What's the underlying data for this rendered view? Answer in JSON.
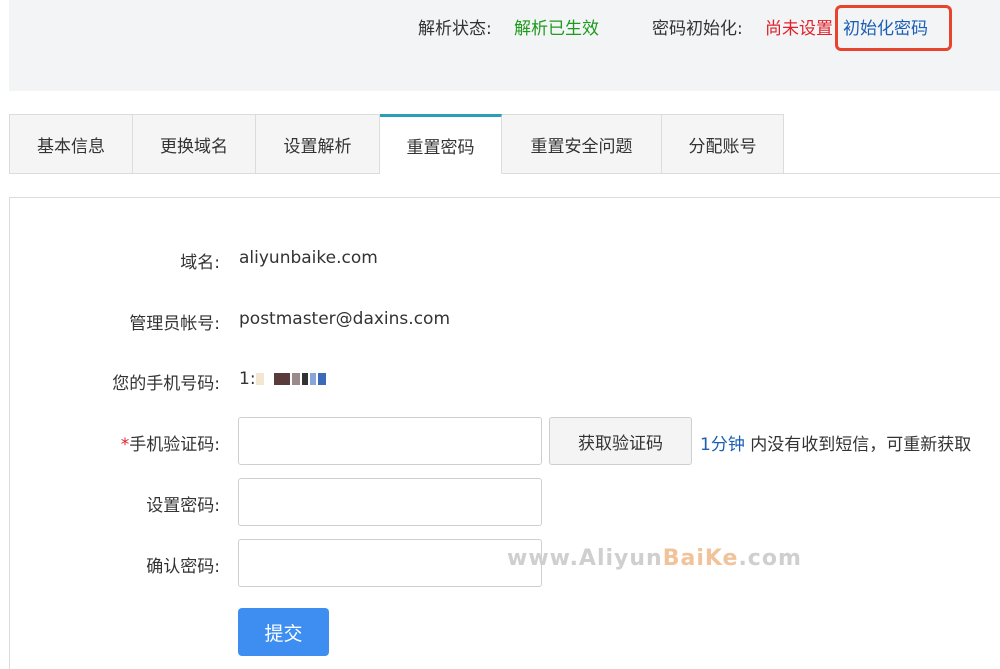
{
  "status": {
    "resolve_label": "解析状态:",
    "resolve_value": "解析已生效",
    "pwd_init_label": "密码初始化:",
    "pwd_init_value": "尚未设置",
    "init_button": "初始化密码"
  },
  "tabs": [
    {
      "label": "基本信息",
      "active": false
    },
    {
      "label": "更换域名",
      "active": false
    },
    {
      "label": "设置解析",
      "active": false
    },
    {
      "label": "重置密码",
      "active": true
    },
    {
      "label": "重置安全问题",
      "active": false
    },
    {
      "label": "分配账号",
      "active": false
    }
  ],
  "form": {
    "domain_label": "域名:",
    "domain_value": "aliyunbaike.com",
    "admin_label": "管理员帐号:",
    "admin_value": "postmaster@daxins.com",
    "phone_label": "您的手机号码:",
    "phone_value": "1:",
    "sms_required": "*",
    "sms_label": "手机验证码:",
    "sms_value": "",
    "get_code_button": "获取验证码",
    "hint_time": "1分钟",
    "hint_text": " 内没有收到短信，可重新获取",
    "set_pwd_label": "设置密码:",
    "set_pwd_value": "",
    "confirm_pwd_label": "确认密码:",
    "confirm_pwd_value": "",
    "submit_button": "提交"
  },
  "watermark": {
    "part1": "www.Aliyun",
    "part2": "BaiKe",
    "part3": ".com"
  },
  "colors": {
    "success": "#1e9a1e",
    "warning": "#e0202a",
    "link": "#1a5fb4",
    "primary_button": "#3d8ef0",
    "active_tab_accent": "#2aa0b8",
    "highlight_box": "#e8442d"
  }
}
